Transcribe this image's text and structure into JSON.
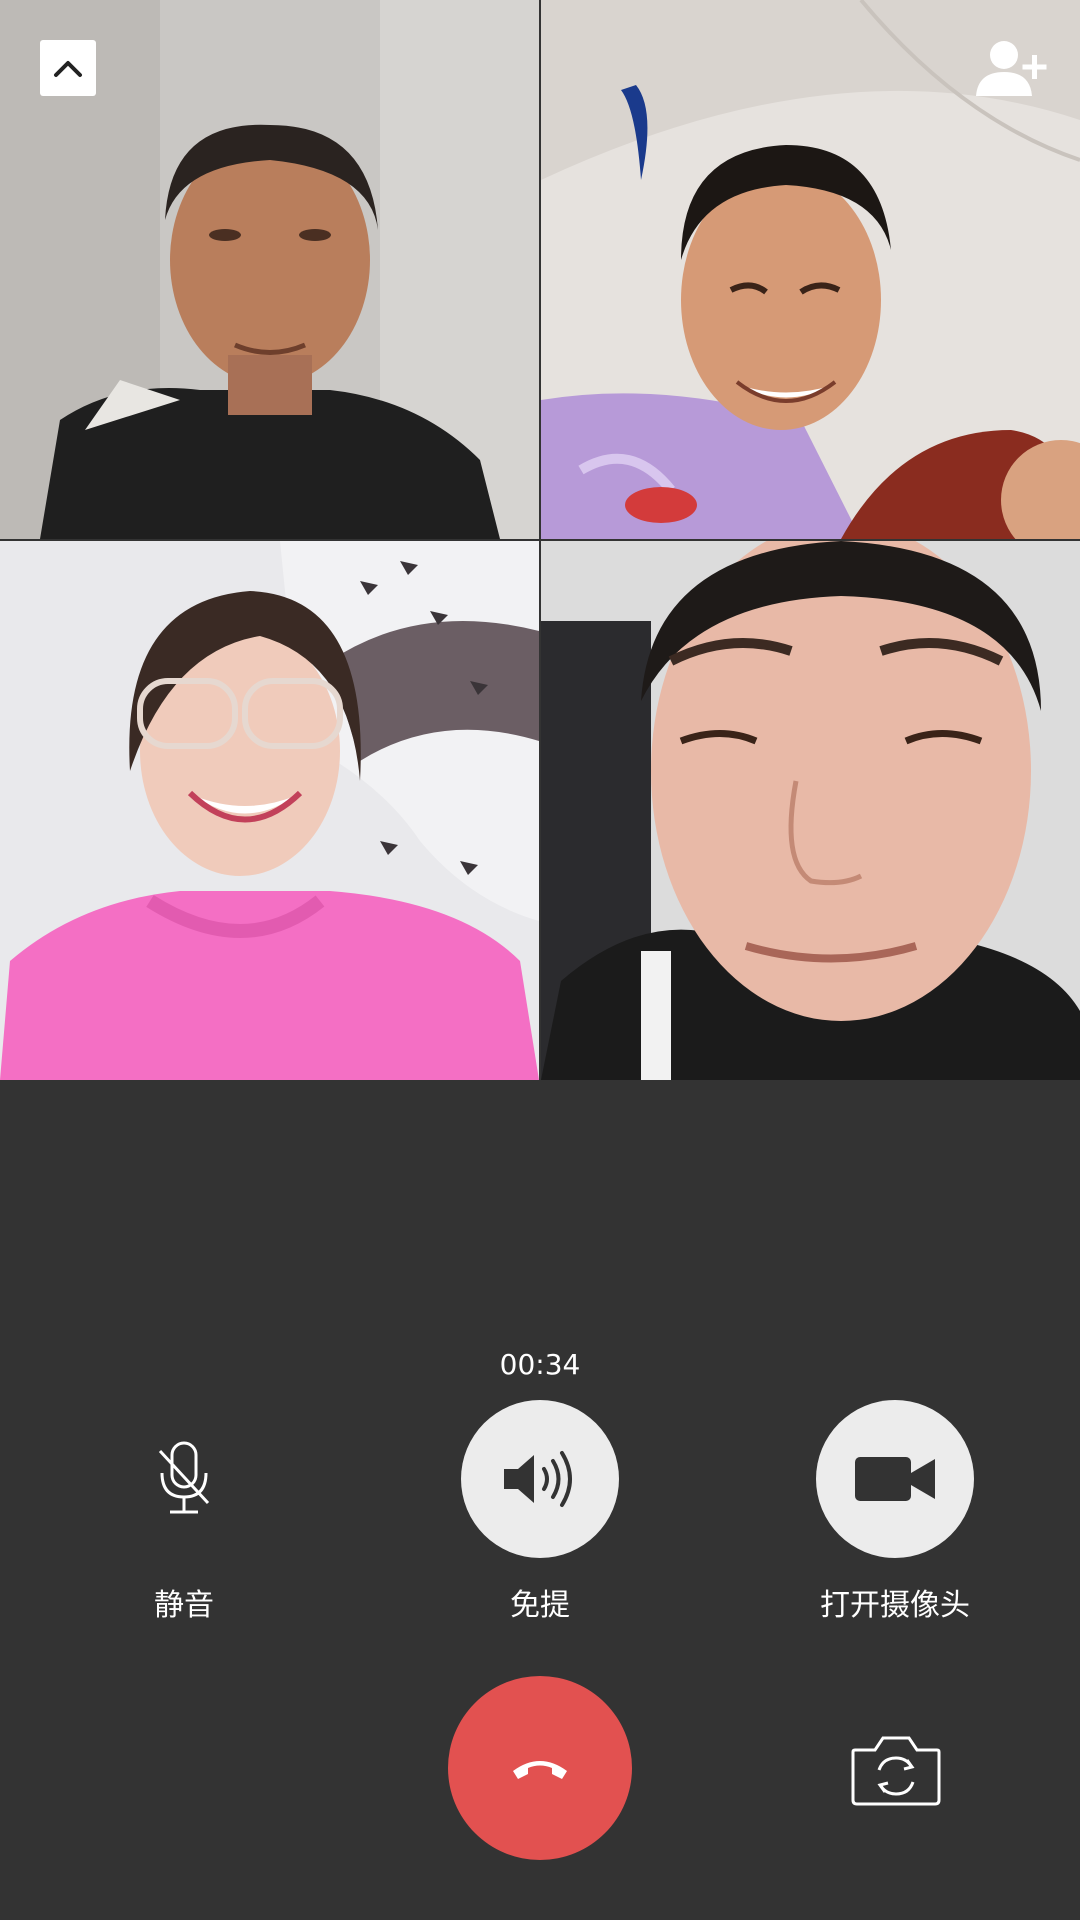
{
  "call": {
    "timer": "00:34"
  },
  "participants": [
    {
      "name": "participant-1",
      "shirt_color": "#1f1f1f"
    },
    {
      "name": "participant-2",
      "shirt_color": "#8a2c1f"
    },
    {
      "name": "participant-3",
      "shirt_color": "#f46fc4"
    },
    {
      "name": "participant-4",
      "shirt_color": "#1b1b1b"
    }
  ],
  "controls": {
    "mute_label": "静音",
    "speaker_label": "免提",
    "camera_label": "打开摄像头"
  },
  "icons": {
    "collapse": "chevron-up-icon",
    "add_member": "add-person-icon",
    "mute": "microphone-muted-icon",
    "speaker": "speaker-icon",
    "camera": "video-camera-icon",
    "hangup": "phone-hangup-icon",
    "flip": "camera-flip-icon"
  },
  "colors": {
    "background": "#333333",
    "hangup": "#e25150",
    "control_circle": "#ececec"
  }
}
